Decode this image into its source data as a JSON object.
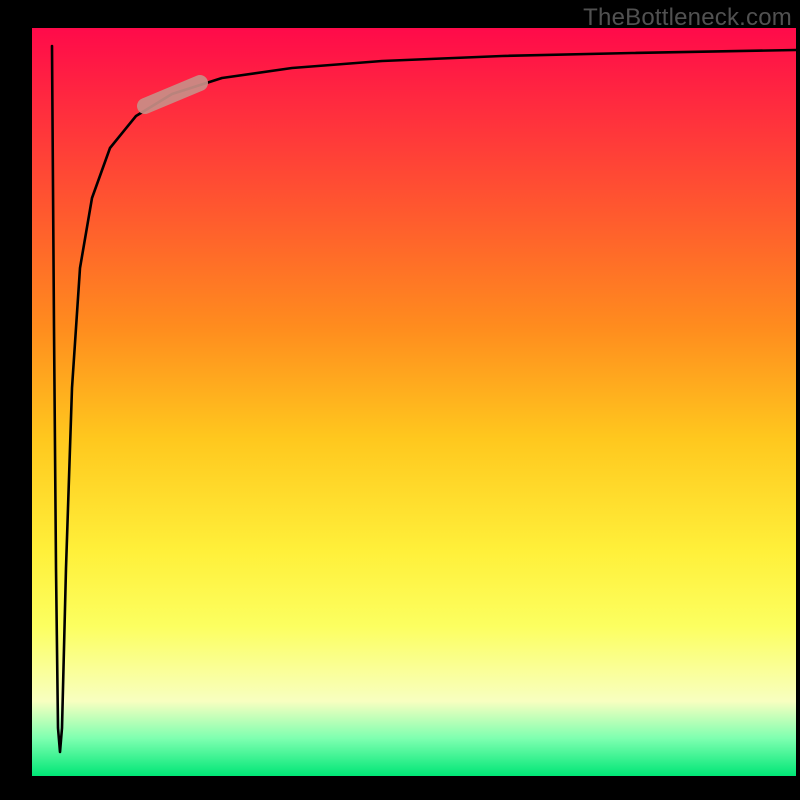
{
  "watermark": "TheBottleneck.com",
  "colors": {
    "gradient_top": "#ff0a4a",
    "gradient_bottom": "#00e676",
    "curve": "#000000",
    "highlight": "#c98e87",
    "frame": "#000000"
  },
  "chart_data": {
    "type": "line",
    "title": "",
    "xlabel": "",
    "ylabel": "",
    "xlim": [
      0,
      100
    ],
    "ylim": [
      0,
      100
    ],
    "grid": false,
    "legend": false,
    "axes_visible": false,
    "note": "Axes and tick labels are not shown; values are estimated proportionally from pixels.",
    "series": [
      {
        "name": "curve",
        "x": [
          2.6,
          3.0,
          3.2,
          3.5,
          4.0,
          4.7,
          5.5,
          7.0,
          9.0,
          12.0,
          16.0,
          22.0,
          30.0,
          40.0,
          55.0,
          70.0,
          85.0,
          100.0
        ],
        "y": [
          98.0,
          55.0,
          30.0,
          8.0,
          30.0,
          55.0,
          68.0,
          78.0,
          84.0,
          88.0,
          90.5,
          92.5,
          93.8,
          94.8,
          95.6,
          96.1,
          96.5,
          97.0
        ]
      }
    ],
    "highlight_segment": {
      "series": "curve",
      "x_range": [
        14.5,
        22.0
      ],
      "y_range": [
        90.0,
        92.5
      ]
    },
    "background_gradient": {
      "direction": "vertical",
      "stops": [
        {
          "pos": 0.0,
          "color": "#ff0a4a"
        },
        {
          "pos": 0.25,
          "color": "#ff5a2e"
        },
        {
          "pos": 0.55,
          "color": "#ffc81e"
        },
        {
          "pos": 0.8,
          "color": "#fcff60"
        },
        {
          "pos": 0.95,
          "color": "#7dffb0"
        },
        {
          "pos": 1.0,
          "color": "#00e676"
        }
      ]
    }
  }
}
